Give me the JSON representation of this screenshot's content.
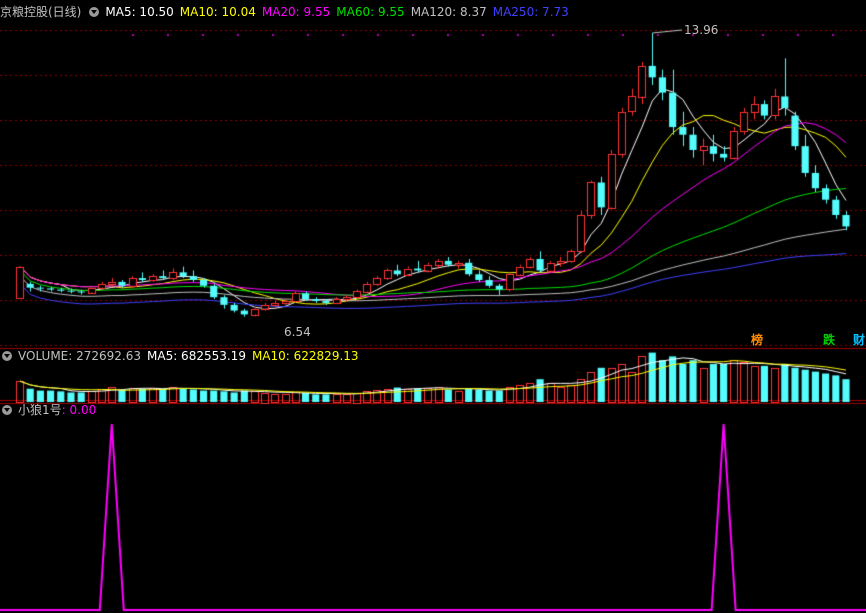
{
  "colors": {
    "background": "#000000",
    "grid": "#8b0000",
    "up": "#ff3232",
    "down": "#54fcfc",
    "ma5": "#ffffff",
    "ma10": "#ffff00",
    "ma20": "#ff00ff",
    "ma60": "#00e000",
    "ma120": "#c0c0c0",
    "ma250": "#4040ff",
    "indicator": "#ff00ff"
  },
  "header": {
    "title": "京粮控股(日线)",
    "ma5": "MA5: 10.50",
    "ma10": "MA10: 10.04",
    "ma20": "MA20: 9.55",
    "ma60": "MA60: 9.55",
    "ma120": "MA120: 8.37",
    "ma250": "MA250: 7.73"
  },
  "volume_header": {
    "label": "VOLUME: 272692.63",
    "ma5": "MA5: 682553.19",
    "ma10": "MA10: 622829.13"
  },
  "indicator_header": {
    "label": "小狼1号",
    "value": ": 0.00"
  },
  "annotations": {
    "high": "13.96",
    "low": "6.54",
    "tags": [
      {
        "text": "榜",
        "color": "#ff8c00"
      },
      {
        "text": "跌",
        "color": "#00d000"
      },
      {
        "text": "财",
        "color": "#00c0ff"
      }
    ]
  },
  "chart_data": {
    "type": "candlestick",
    "price_range": [
      5.8,
      14.3
    ],
    "candles": [
      [
        7.05,
        7.85,
        7.05,
        7.85
      ],
      [
        7.4,
        7.45,
        7.2,
        7.3
      ],
      [
        7.3,
        7.35,
        7.2,
        7.28
      ],
      [
        7.28,
        7.32,
        7.2,
        7.25
      ],
      [
        7.25,
        7.3,
        7.18,
        7.22
      ],
      [
        7.22,
        7.28,
        7.15,
        7.2
      ],
      [
        7.2,
        7.25,
        7.12,
        7.18
      ],
      [
        7.18,
        7.35,
        7.15,
        7.3
      ],
      [
        7.3,
        7.45,
        7.25,
        7.4
      ],
      [
        7.4,
        7.55,
        7.35,
        7.45
      ],
      [
        7.45,
        7.5,
        7.3,
        7.35
      ],
      [
        7.35,
        7.6,
        7.3,
        7.55
      ],
      [
        7.55,
        7.7,
        7.45,
        7.5
      ],
      [
        7.5,
        7.65,
        7.45,
        7.6
      ],
      [
        7.6,
        7.75,
        7.5,
        7.55
      ],
      [
        7.55,
        7.8,
        7.5,
        7.7
      ],
      [
        7.7,
        7.85,
        7.55,
        7.6
      ],
      [
        7.6,
        7.75,
        7.45,
        7.5
      ],
      [
        7.5,
        7.55,
        7.3,
        7.35
      ],
      [
        7.35,
        7.4,
        7.0,
        7.05
      ],
      [
        7.05,
        7.1,
        6.75,
        6.85
      ],
      [
        6.85,
        6.9,
        6.65,
        6.7
      ],
      [
        6.7,
        6.75,
        6.54,
        6.6
      ],
      [
        6.6,
        6.8,
        6.55,
        6.75
      ],
      [
        6.75,
        6.9,
        6.7,
        6.85
      ],
      [
        6.85,
        6.95,
        6.8,
        6.9
      ],
      [
        6.9,
        7.0,
        6.85,
        6.95
      ],
      [
        6.95,
        7.2,
        6.9,
        7.15
      ],
      [
        7.15,
        7.2,
        6.95,
        7.0
      ],
      [
        7.0,
        7.05,
        6.9,
        6.95
      ],
      [
        6.95,
        7.0,
        6.85,
        6.9
      ],
      [
        6.9,
        7.05,
        6.88,
        7.0
      ],
      [
        7.0,
        7.1,
        6.95,
        7.05
      ],
      [
        7.05,
        7.25,
        7.0,
        7.2
      ],
      [
        7.2,
        7.45,
        7.15,
        7.4
      ],
      [
        7.4,
        7.6,
        7.35,
        7.55
      ],
      [
        7.55,
        7.8,
        7.5,
        7.75
      ],
      [
        7.75,
        7.9,
        7.6,
        7.65
      ],
      [
        7.65,
        7.85,
        7.6,
        7.8
      ],
      [
        7.8,
        8.0,
        7.7,
        7.75
      ],
      [
        7.75,
        7.95,
        7.7,
        7.9
      ],
      [
        7.9,
        8.05,
        7.8,
        8.0
      ],
      [
        8.0,
        8.1,
        7.85,
        7.9
      ],
      [
        7.9,
        8.0,
        7.8,
        7.95
      ],
      [
        7.95,
        8.05,
        7.6,
        7.65
      ],
      [
        7.65,
        7.75,
        7.45,
        7.5
      ],
      [
        7.5,
        7.6,
        7.3,
        7.35
      ],
      [
        7.35,
        7.4,
        7.1,
        7.25
      ],
      [
        7.25,
        7.7,
        7.2,
        7.65
      ],
      [
        7.65,
        7.9,
        7.6,
        7.85
      ],
      [
        7.85,
        8.1,
        7.8,
        8.05
      ],
      [
        8.05,
        8.25,
        7.7,
        7.75
      ],
      [
        7.75,
        8.0,
        7.7,
        7.95
      ],
      [
        7.95,
        8.1,
        7.85,
        8.0
      ],
      [
        8.0,
        8.3,
        7.95,
        8.25
      ],
      [
        8.25,
        9.3,
        8.2,
        9.2
      ],
      [
        9.2,
        10.1,
        9.1,
        10.05
      ],
      [
        10.05,
        10.2,
        9.2,
        9.4
      ],
      [
        9.4,
        10.9,
        9.35,
        10.8
      ],
      [
        10.8,
        12.0,
        10.7,
        11.9
      ],
      [
        11.9,
        12.5,
        11.8,
        12.3
      ],
      [
        12.3,
        13.2,
        12.1,
        13.1
      ],
      [
        13.1,
        13.96,
        12.6,
        12.8
      ],
      [
        12.8,
        13.0,
        12.2,
        12.4
      ],
      [
        12.4,
        13.0,
        11.3,
        11.5
      ],
      [
        11.5,
        11.9,
        11.0,
        11.3
      ],
      [
        11.3,
        11.5,
        10.7,
        10.9
      ],
      [
        10.9,
        11.2,
        10.5,
        11.0
      ],
      [
        11.0,
        11.3,
        10.6,
        10.8
      ],
      [
        10.8,
        11.0,
        10.6,
        10.7
      ],
      [
        10.7,
        11.5,
        10.65,
        11.4
      ],
      [
        11.4,
        12.0,
        11.3,
        11.9
      ],
      [
        11.9,
        12.3,
        11.7,
        12.1
      ],
      [
        12.1,
        12.2,
        11.7,
        11.8
      ],
      [
        11.8,
        12.5,
        11.7,
        12.3
      ],
      [
        12.3,
        13.3,
        11.8,
        12.0
      ],
      [
        11.8,
        11.9,
        10.9,
        11.0
      ],
      [
        11.0,
        11.3,
        10.2,
        10.3
      ],
      [
        10.3,
        10.5,
        9.8,
        9.9
      ],
      [
        9.9,
        10.0,
        9.5,
        9.6
      ],
      [
        9.6,
        9.7,
        9.1,
        9.2
      ],
      [
        9.2,
        9.3,
        8.8,
        8.9
      ]
    ],
    "volumes": [
      0.55,
      0.35,
      0.3,
      0.3,
      0.28,
      0.25,
      0.25,
      0.3,
      0.35,
      0.4,
      0.32,
      0.38,
      0.35,
      0.36,
      0.34,
      0.4,
      0.35,
      0.33,
      0.3,
      0.3,
      0.28,
      0.25,
      0.3,
      0.28,
      0.25,
      0.22,
      0.22,
      0.26,
      0.24,
      0.2,
      0.2,
      0.2,
      0.22,
      0.25,
      0.3,
      0.32,
      0.35,
      0.38,
      0.35,
      0.36,
      0.38,
      0.4,
      0.33,
      0.3,
      0.35,
      0.33,
      0.3,
      0.3,
      0.4,
      0.45,
      0.5,
      0.6,
      0.5,
      0.4,
      0.45,
      0.6,
      0.8,
      0.9,
      0.9,
      1.0,
      0.8,
      1.2,
      1.3,
      1.1,
      1.2,
      1.0,
      1.1,
      0.9,
      1.0,
      1.0,
      1.1,
      1.05,
      0.95,
      0.95,
      0.9,
      1.0,
      0.9,
      0.85,
      0.8,
      0.75,
      0.7,
      0.6
    ],
    "indicator": {
      "spikes_at": [
        9,
        69
      ],
      "base": 0,
      "peak": 1
    }
  }
}
